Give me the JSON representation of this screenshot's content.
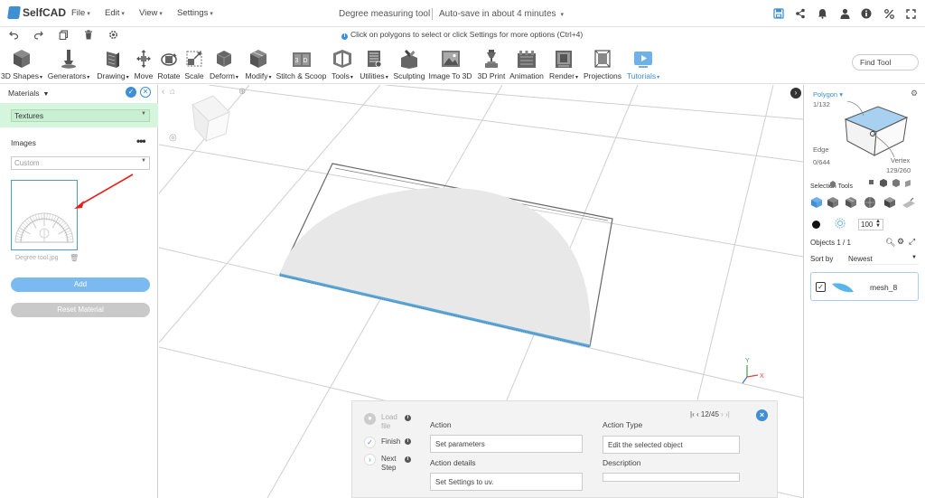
{
  "app": {
    "logo": "SelfCAD",
    "menus": [
      "File",
      "Edit",
      "View",
      "Settings"
    ],
    "doc_title": "Degree measuring tool",
    "autosave": "Auto-save in about 4 minutes",
    "hint": "Click on polygons to select or click Settings for more options (Ctrl+4)",
    "header_icons": [
      "save-icon",
      "share-icon",
      "bell-icon",
      "user-icon",
      "info-icon",
      "percent-icon",
      "expand-icon"
    ],
    "quick_icons": [
      "undo-icon",
      "redo-icon",
      "copy-icon",
      "trash-icon",
      "settings-cog-icon"
    ]
  },
  "toolbar": {
    "tools": [
      {
        "label": "3D Shapes",
        "icon": "cube-icon",
        "dropdown": true
      },
      {
        "label": "Generators",
        "icon": "generators-icon",
        "dropdown": true
      },
      {
        "label": "Drawing",
        "icon": "drawing-icon",
        "dropdown": true
      },
      {
        "label": "Move",
        "icon": "move-icon",
        "dropdown": false
      },
      {
        "label": "Rotate",
        "icon": "rotate-icon",
        "dropdown": false
      },
      {
        "label": "Scale",
        "icon": "scale-icon",
        "dropdown": false
      },
      {
        "label": "Deform",
        "icon": "deform-icon",
        "dropdown": true
      },
      {
        "label": "Modify",
        "icon": "modify-icon",
        "dropdown": true
      },
      {
        "label": "Stitch & Scoop",
        "icon": "stitch-icon",
        "dropdown": false
      },
      {
        "label": "Tools",
        "icon": "tools-icon",
        "dropdown": true
      },
      {
        "label": "Utilities",
        "icon": "utilities-icon",
        "dropdown": true
      },
      {
        "label": "Sculpting",
        "icon": "sculpting-icon",
        "dropdown": false
      },
      {
        "label": "Image To 3D",
        "icon": "image-to-3d-icon",
        "dropdown": false
      },
      {
        "label": "3D Print",
        "icon": "print-icon",
        "dropdown": false
      },
      {
        "label": "Animation",
        "icon": "animation-icon",
        "dropdown": false
      },
      {
        "label": "Render",
        "icon": "render-icon",
        "dropdown": true
      },
      {
        "label": "Projections",
        "icon": "projections-icon",
        "dropdown": false
      },
      {
        "label": "Tutorials",
        "icon": "tutorials-icon",
        "dropdown": true
      }
    ],
    "find_tool": "Find Tool"
  },
  "materials": {
    "title": "Materials",
    "texture_select": "Textures",
    "images_label": "Images",
    "custom_select": "Custom",
    "thumb_caption": "Degree tool.jpg",
    "add_button": "Add",
    "reset_button": "Reset Material"
  },
  "selection": {
    "polygon_label": "Polygon",
    "polygon_count": "1/132",
    "edge_label": "Edge",
    "edge_count": "0/644",
    "vertex_label": "Vertex",
    "vertex_count": "129/260",
    "tools_label": "Selection Tools",
    "size_value": "100",
    "objects_label": "Objects 1 / 1",
    "sort_label": "Sort by",
    "sort_value": "Newest",
    "object_name": "mesh_8"
  },
  "tutorial": {
    "steps": [
      {
        "label": "Load file",
        "state": "pending"
      },
      {
        "label": "Finish",
        "state": "done"
      },
      {
        "label": "Next Step",
        "state": "next"
      }
    ],
    "action_label": "Action",
    "action_value": "Set parameters",
    "action_details_label": "Action details",
    "action_details_value": "Set Settings to uv.",
    "action_type_label": "Action Type",
    "action_type_value": "Edit the selected object",
    "description_label": "Description",
    "description_value": "",
    "pager": "12/45"
  },
  "colors": {
    "accent": "#3f8fd4",
    "green_bar": "#d6f5dd",
    "edge_highlight": "#5aa8d8"
  }
}
